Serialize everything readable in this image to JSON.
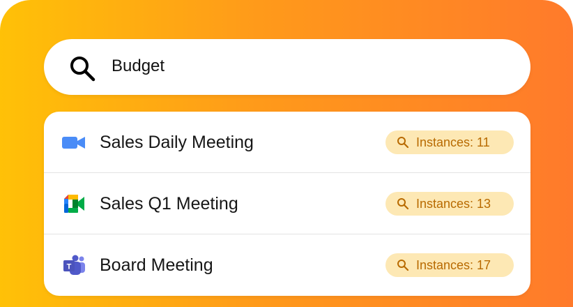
{
  "colors": {
    "gradient_start": "#FFC107",
    "gradient_end": "#FF7A2B",
    "badge_bg": "#FDE8B4",
    "badge_text": "#B86A00"
  },
  "search": {
    "icon": "search-icon",
    "query": "Budget"
  },
  "results": [
    {
      "app_icon": "zoom-video-icon",
      "title": "Sales Daily Meeting",
      "badge_icon": "search-icon",
      "badge": "Instances: 11"
    },
    {
      "app_icon": "google-meet-icon",
      "title": "Sales Q1 Meeting",
      "badge_icon": "search-icon",
      "badge": "Instances: 13"
    },
    {
      "app_icon": "microsoft-teams-icon",
      "title": "Board Meeting",
      "badge_icon": "search-icon",
      "badge": "Instances: 17"
    }
  ]
}
